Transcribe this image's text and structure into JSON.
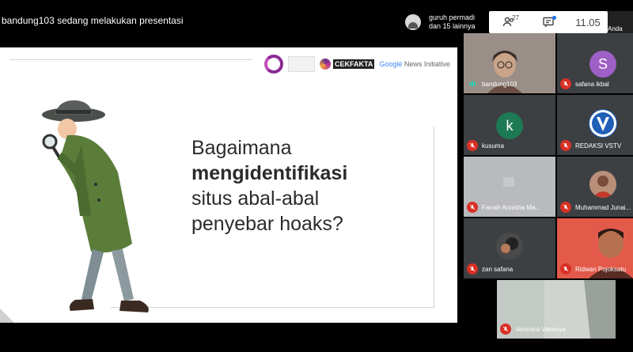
{
  "topbar": {
    "presenting_text": "bandung103 sedang melakukan presentasi",
    "participants_line1": "guruh permadi",
    "participants_line2": "dan 15 lainnya",
    "people_count": "27",
    "clock": "11.05",
    "self_label": "Anda"
  },
  "slide": {
    "title_line1": "Bagaimana",
    "title_line2": "mengidentifikasi",
    "title_line3": "situs abal-abal",
    "title_line4": "penyebar hoaks?",
    "logo_cekfakta": "CEKFAKTA",
    "logo_google": "Google",
    "logo_news_initiative": " News Initiative"
  },
  "participants": [
    {
      "name": "bandung103",
      "muted": false,
      "kind": "video",
      "bg": "#8b7d77"
    },
    {
      "name": "safana ikbal",
      "muted": true,
      "kind": "letter",
      "letter": "S",
      "color": "#9e5fc6"
    },
    {
      "name": "kusuma",
      "muted": true,
      "kind": "letter",
      "letter": "k",
      "color": "#1e7a55"
    },
    {
      "name": "REDAKSI VSTV",
      "muted": true,
      "kind": "logo"
    },
    {
      "name": "Farrah Annisha Ma...",
      "muted": true,
      "kind": "video",
      "bg": "#b9babd"
    },
    {
      "name": "Muhammad Junai...",
      "muted": true,
      "kind": "photo"
    },
    {
      "name": "zan safana",
      "muted": true,
      "kind": "photo"
    },
    {
      "name": "Ridwan Pojoksatu",
      "muted": true,
      "kind": "video",
      "bg": "#e35a4b"
    },
    {
      "name": "Veronica Vanesya",
      "muted": true,
      "kind": "video",
      "bg": "#cfd4cf"
    }
  ],
  "colors": {
    "muted_red": "#d93025",
    "tile_bg": "#3c4043",
    "accent_blue": "#1a73e8"
  }
}
